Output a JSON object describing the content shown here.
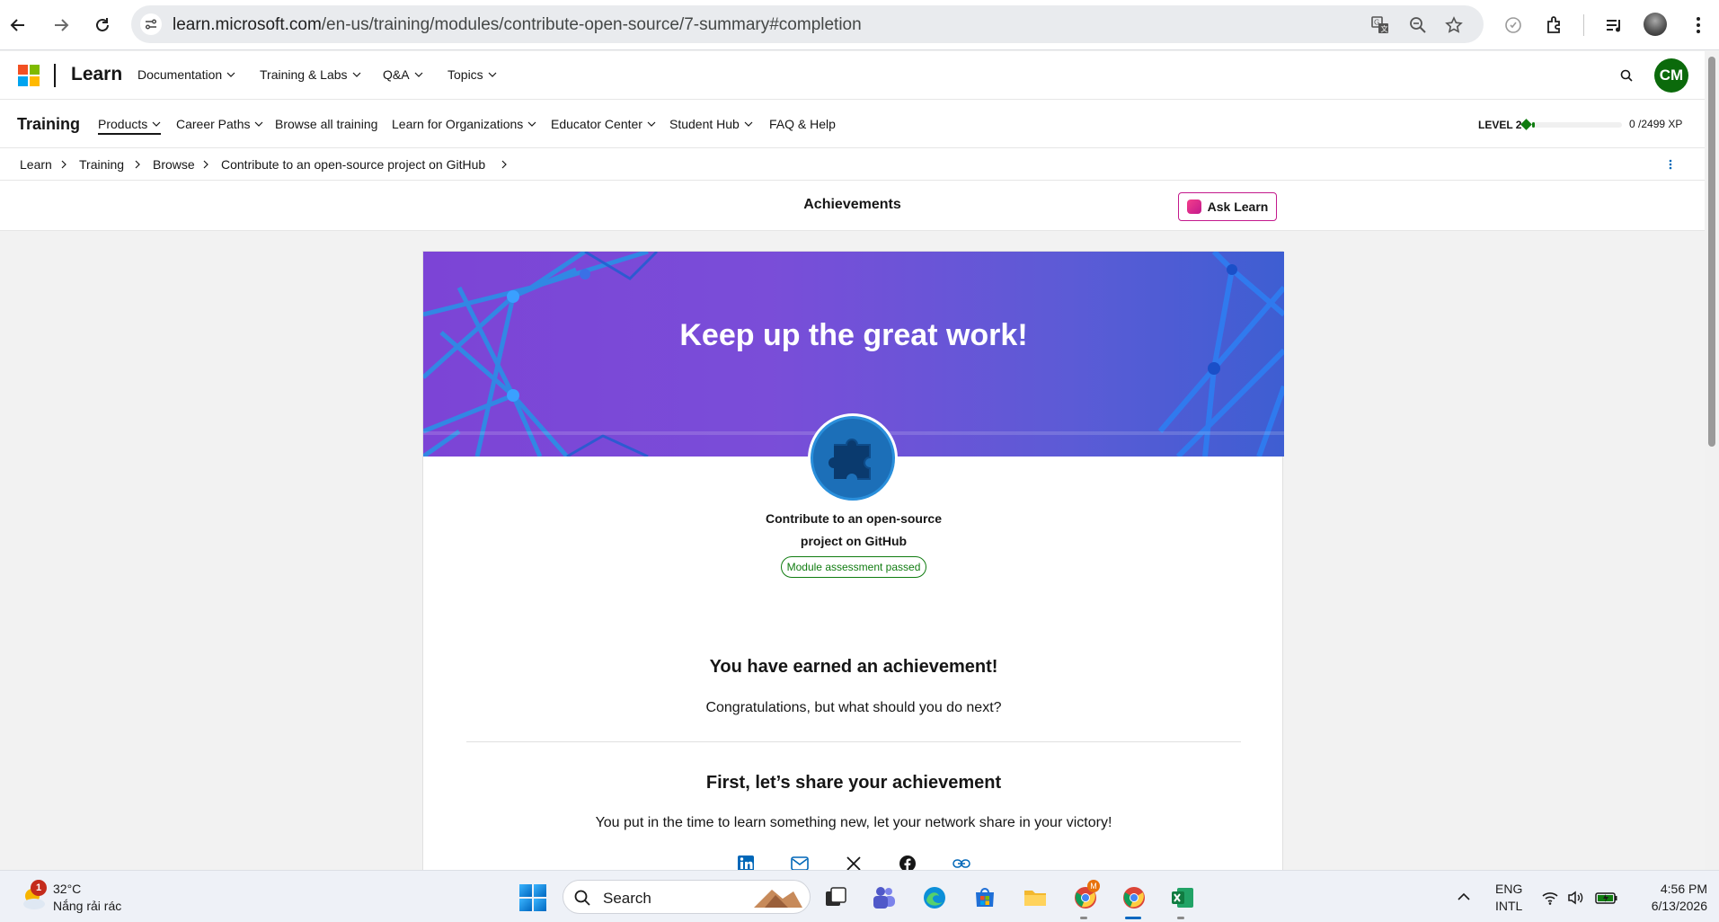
{
  "browser": {
    "url_host": "learn.microsoft.com",
    "url_path": "/en-us/training/modules/contribute-open-source/7-summary#completion"
  },
  "site_header": {
    "brand": "Learn",
    "nav": [
      "Documentation",
      "Training & Labs",
      "Q&A",
      "Topics"
    ],
    "avatar_initials": "CM"
  },
  "training_nav": {
    "brand": "Training",
    "items": [
      "Products",
      "Career Paths",
      "Browse all training",
      "Learn for Organizations",
      "Educator Center",
      "Student Hub",
      "FAQ & Help"
    ],
    "level": "LEVEL 2",
    "xp": "0 /2499 XP",
    "xp_progress": 0.03
  },
  "breadcrumb": [
    "Learn",
    "Training",
    "Browse",
    "Contribute to an open-source project on GitHub"
  ],
  "achievements_bar": {
    "title": "Achievements",
    "ask_learn": "Ask Learn"
  },
  "card": {
    "banner_title": "Keep up the great work!",
    "module_name_line1": "Contribute to an open-source",
    "module_name_line2": "project on GitHub",
    "status": "Module assessment passed",
    "earned_heading": "You have earned an achievement!",
    "earned_text": "Congratulations, but what should you do next?",
    "share_heading": "First, let’s share your achievement",
    "share_text": "You put in the time to learn something new, let your network share in your victory!",
    "share_icons": [
      "linkedin-icon",
      "email-icon",
      "x-icon",
      "facebook-icon",
      "link-icon"
    ]
  },
  "colors": {
    "accent": "#0067b8",
    "success": "#107c10",
    "ask_learn_border": "#c3198c",
    "avatar": "#0b6a0b"
  },
  "taskbar": {
    "notification_count": "1",
    "temperature": "32°C",
    "condition": "Nắng rải rác",
    "search_label": "Search",
    "lang_line1": "ENG",
    "lang_line2": "INTL",
    "time": "4:56 PM",
    "date": "6/13/2026",
    "chrome_badge": "M"
  }
}
